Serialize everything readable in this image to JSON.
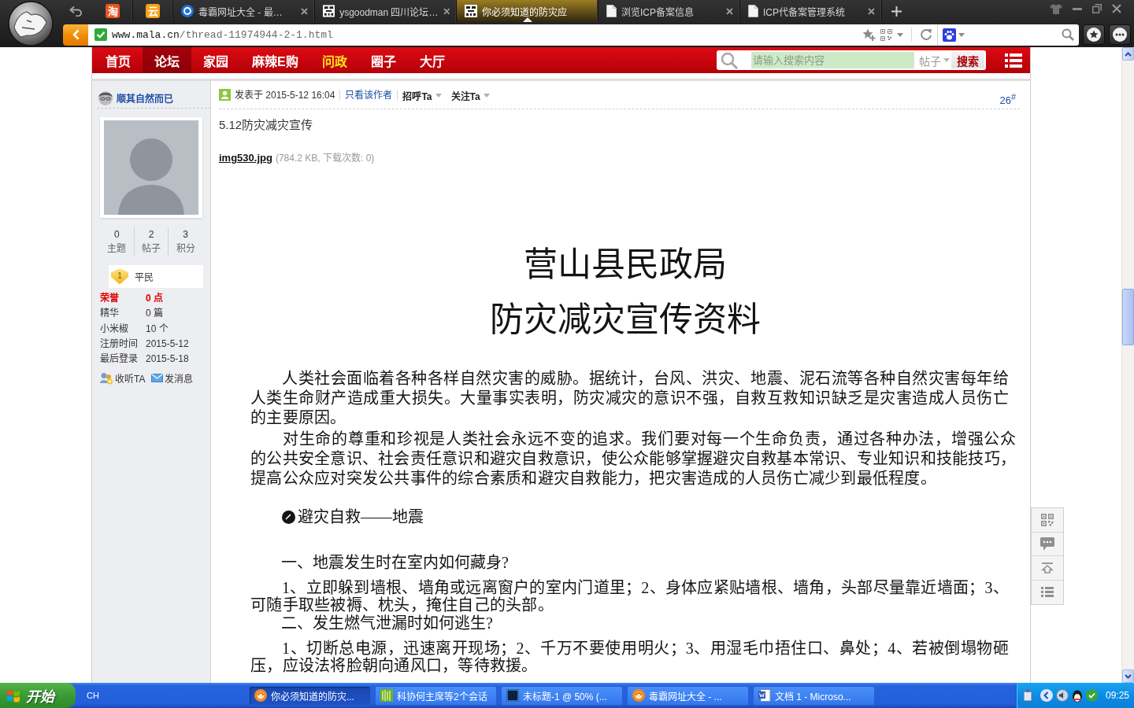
{
  "browser": {
    "tabs": [
      {
        "kind": "pinned",
        "label": "淘",
        "color": "#e9541f",
        "selected": false
      },
      {
        "kind": "pinned",
        "label": "云",
        "color": "#f5a21c",
        "selected": false
      },
      {
        "kind": "portal",
        "label": "毒霸网址大全 - 最…",
        "selected": false
      },
      {
        "kind": "forum",
        "label": "ysgoodman 四川论坛…",
        "selected": false
      },
      {
        "kind": "forum",
        "label": "你必须知道的防灾应",
        "selected": true
      },
      {
        "kind": "document",
        "label": "浏览ICP备案信息",
        "selected": false
      },
      {
        "kind": "document",
        "label": "ICP代备案管理系统",
        "selected": false
      }
    ],
    "address": {
      "host": "www.mala.cn",
      "path": "/thread-11974944-2-1.html"
    }
  },
  "site_nav": {
    "items": [
      {
        "label": "首页",
        "selected": false,
        "highlighted": false
      },
      {
        "label": "论坛",
        "selected": true,
        "highlighted": false
      },
      {
        "label": "家园",
        "selected": false,
        "highlighted": false
      },
      {
        "label": "麻辣E购",
        "selected": false,
        "highlighted": false
      },
      {
        "label": "问政",
        "selected": false,
        "highlighted": true
      },
      {
        "label": "圈子",
        "selected": false,
        "highlighted": false
      },
      {
        "label": "大厅",
        "selected": false,
        "highlighted": false
      }
    ],
    "search": {
      "placeholder": "请输入搜索内容",
      "scope": "帖子",
      "button": "搜索"
    }
  },
  "author": {
    "name": "顺其自然而已",
    "stats": [
      {
        "value": "0",
        "label": "主题"
      },
      {
        "value": "2",
        "label": "帖子"
      },
      {
        "value": "3",
        "label": "积分"
      }
    ],
    "level": "1",
    "rank": "平民",
    "details": [
      {
        "label": "荣誉",
        "value": "0 点",
        "emphasis": true
      },
      {
        "label": "精华",
        "value": "0 篇",
        "emphasis": false
      },
      {
        "label": "小米椒",
        "value": "10 个",
        "emphasis": false
      },
      {
        "label": "注册时间",
        "value": "2015-5-12",
        "emphasis": false
      },
      {
        "label": "最后登录",
        "value": "2015-5-18",
        "emphasis": false
      }
    ],
    "actions": [
      {
        "kind": "follow",
        "label": "收听TA"
      },
      {
        "kind": "message",
        "label": "发消息"
      }
    ]
  },
  "post": {
    "posted": "发表于 2015-5-12 16:04",
    "author_only": "只看该作者",
    "menus": [
      "招呼Ta",
      "关注Ta"
    ],
    "floor": "26$^{#}$",
    "title": "5.12防灾减灾宣传",
    "attachment": {
      "name": "img530.jpg",
      "meta": "(784.2 KB, 下载次数: 0)"
    }
  },
  "document": {
    "title_lines": [
      "营山县民政局",
      "防灾减灾宣传资料"
    ],
    "blocks": [
      {
        "kind": "paragraph",
        "text": "人类社会面临着各种各样自然灾害的威胁。据统计，台风、洪灾、地震、泥石流等各种自然灾害每年给人类生命财产造成重大损失。大量事实表明，防灾减灾的意识不强，自救互救知识缺乏是灾害造成人员伤亡的主要原因。"
      },
      {
        "kind": "paragraph",
        "text": "对生命的尊重和珍视是人类社会永远不变的追求。我们要对每一个生命负责，通过各种办法，增强公众的公共安全意识、社会责任意识和避灾自救意识，使公众能够掌握避灾自救基本常识、专业知识和技能技巧，提高公众应对突发公共事件的综合素质和避灾自救能力，把灾害造成的人员伤亡减少到最低程度。"
      },
      {
        "kind": "heading",
        "text": "避灾自救——地震"
      },
      {
        "kind": "question",
        "text": "一、地震发生时在室内如何藏身?"
      },
      {
        "kind": "answer",
        "text": "1、立即躲到墙根、墙角或远离窗户的室内门道里；2、身体应紧贴墙根、墙角，头部尽量靠近墙面；3、可随手取些被褥、枕头，掩住自己的头部。"
      },
      {
        "kind": "question",
        "text": "二、发生燃气泄漏时如何逃生?"
      },
      {
        "kind": "answer",
        "text": "1、切断总电源，迅速离开现场；2、千万不要使用明火；3、用湿毛巾捂住口、鼻处；4、若被倒塌物砸压，应设法将脸朝向通风口，等待救援。"
      }
    ]
  },
  "taskbar": {
    "start": "开始",
    "language": "CH",
    "tasks": [
      {
        "kind": "browser",
        "label": "你必须知道的防灾...",
        "selected": true
      },
      {
        "kind": "chat",
        "label": "科协何主席等2个会话",
        "selected": false
      },
      {
        "kind": "image-editor",
        "label": "未标题-1 @ 50% (...",
        "selected": false
      },
      {
        "kind": "browser",
        "label": "毒霸网址大全 - ...",
        "selected": false
      },
      {
        "kind": "word",
        "label": "文档 1 - Microso...",
        "selected": false
      }
    ],
    "clock": "09:25"
  }
}
